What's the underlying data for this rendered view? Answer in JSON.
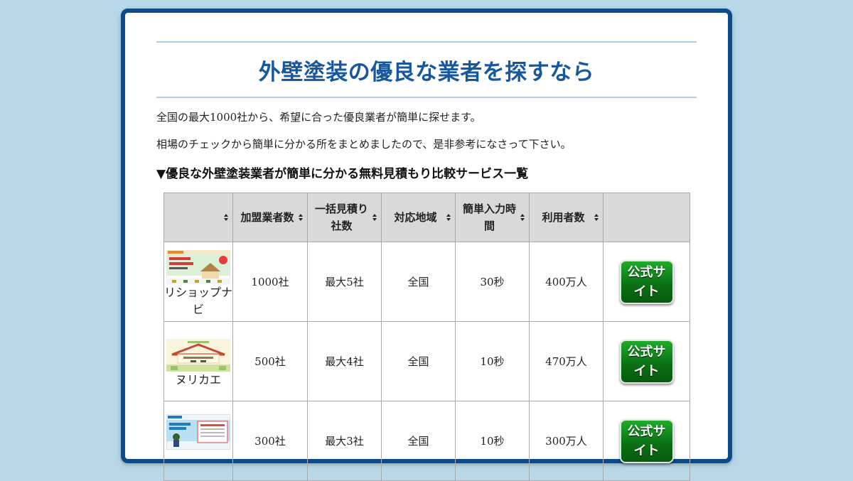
{
  "page": {
    "title": "外壁塗装の優良な業者を探すなら",
    "intro1": "全国の最大1000社から、希望に合った優良業者が簡単に探せます。",
    "intro2": "相場のチェックから簡単に分かる所をまとめましたので、是非参考になさって下さい。",
    "section_heading": "▼優良な外壁塗装業者が簡単に分かる無料見積もり比較サービス一覧"
  },
  "table": {
    "headers": [
      "",
      "加盟業者数",
      "一括見積り社数",
      "対応地域",
      "簡単入力時間",
      "利用者数",
      ""
    ],
    "rows": [
      {
        "name": "リショップナビ",
        "members": "1000社",
        "quotes": "最大5社",
        "area": "全国",
        "time": "30秒",
        "users": "400万人",
        "button": "公式サイト"
      },
      {
        "name": "ヌリカエ",
        "members": "500社",
        "quotes": "最大4社",
        "area": "全国",
        "time": "10秒",
        "users": "470万人",
        "button": "公式サイト"
      },
      {
        "name": "",
        "members": "300社",
        "quotes": "最大3社",
        "area": "全国",
        "time": "10秒",
        "users": "300万人",
        "button": "公式サイト"
      }
    ]
  },
  "colors": {
    "background": "#b8d7e8",
    "card_border": "#0b4a8b",
    "title": "#17579e",
    "button": "#0a6e12"
  }
}
